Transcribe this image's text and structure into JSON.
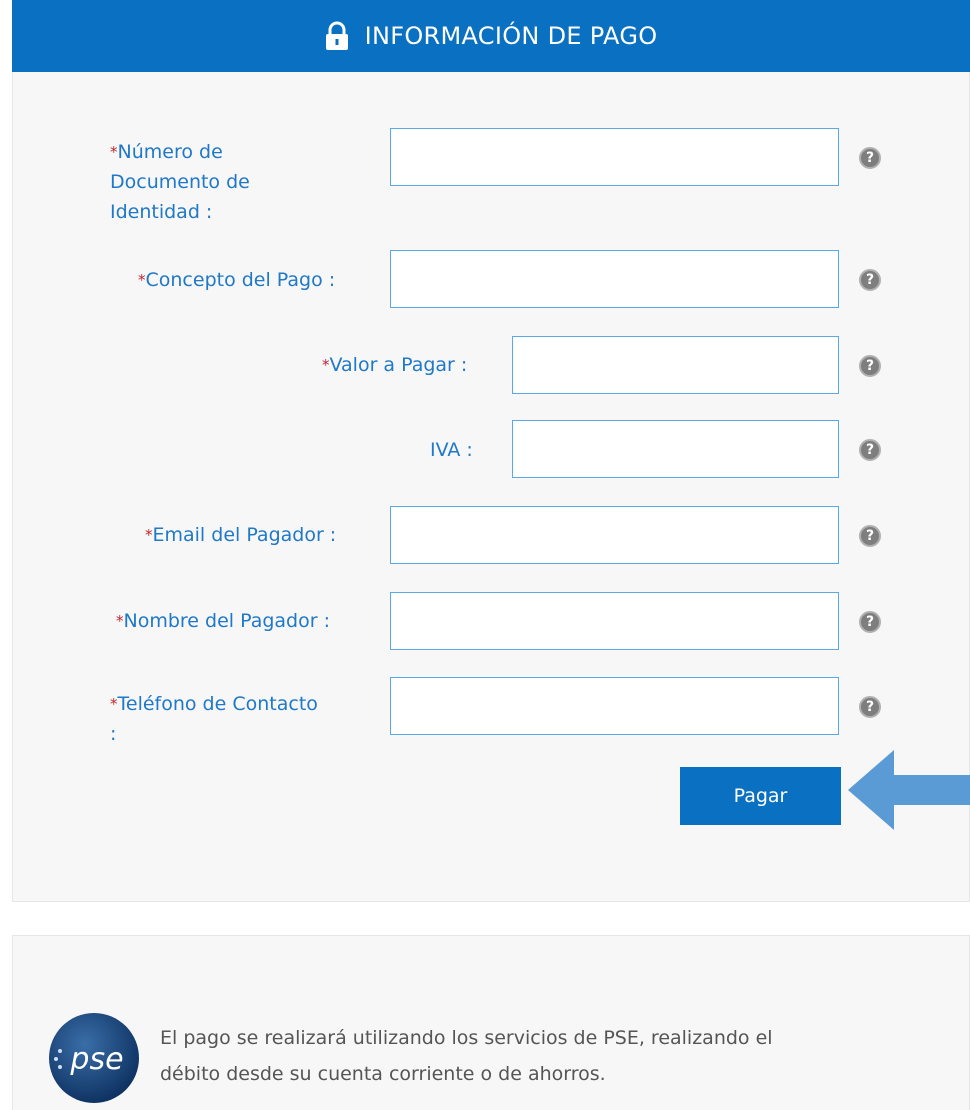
{
  "header": {
    "title": "INFORMACIÓN DE PAGO",
    "icon": "lock-icon"
  },
  "form": {
    "required_mark": "*",
    "help_glyph": "?",
    "fields": [
      {
        "label_lines": [
          "Número de",
          "Documento de",
          "Identidad :"
        ],
        "required": true,
        "value": ""
      },
      {
        "label": "Concepto del Pago :",
        "required": true,
        "value": ""
      },
      {
        "label": "Valor a Pagar :",
        "required": true,
        "value": ""
      },
      {
        "label": "IVA :",
        "required": false,
        "value": ""
      },
      {
        "label": "Email del Pagador :",
        "required": true,
        "value": ""
      },
      {
        "label": "Nombre del Pagador :",
        "required": true,
        "value": ""
      },
      {
        "label_lines": [
          "Teléfono de Contacto",
          ":"
        ],
        "required": true,
        "value": ""
      }
    ],
    "submit_label": "Pagar"
  },
  "info": {
    "logo_text": "pse",
    "text_lines": [
      "El pago se realizará utilizando los servicios de PSE, realizando el",
      "débito desde su cuenta corriente o de ahorros."
    ]
  },
  "colors": {
    "primary": "#0970c2",
    "label": "#1f78c8",
    "required": "#c0272d",
    "arrow": "#5b9bd5"
  }
}
